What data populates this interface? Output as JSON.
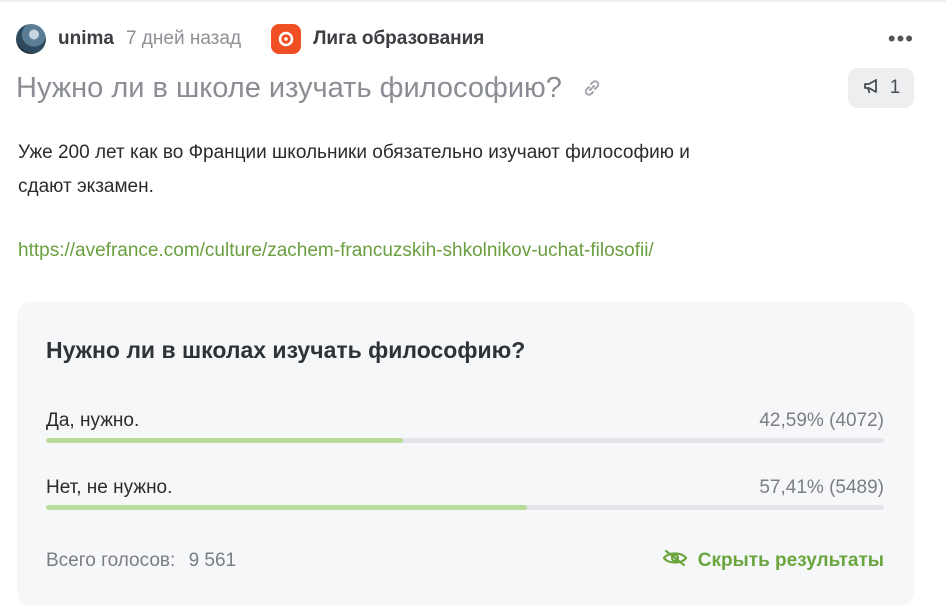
{
  "post": {
    "author": "unima",
    "time": "7 дней назад",
    "community": "Лига образования",
    "more_label": "•••",
    "title": "Нужно ли в школе изучать философию?",
    "pin_count": "1",
    "body_lines": [
      "Уже 200 лет как во Франции школьники обязательно изучают философию и",
      "сдают экзамен."
    ],
    "url": "https://avefrance.com/culture/zachem-francuzskih-shkolnikov-uchat-filosofii/"
  },
  "poll": {
    "question": "Нужно ли в школах изучать философию?",
    "options": [
      {
        "label": "Да, нужно.",
        "stat": "42,59% (4072)",
        "fraction": 0.4259
      },
      {
        "label": "Нет, не нужно.",
        "stat": "57,41% (5489)",
        "fraction": 0.5741
      }
    ],
    "total_label": "Всего голосов:",
    "total_value": "9 561",
    "hide_label": "Скрыть результаты"
  },
  "colors": {
    "accent_green": "#6aa53d",
    "bar_fill": "#b9dc9a",
    "community_icon_bg": "#f04e23"
  },
  "icons": {
    "community": "community-logo-icon",
    "link": "link-icon",
    "pin": "megaphone-icon",
    "hide": "eye-off-icon",
    "more": "more-dots-icon"
  }
}
